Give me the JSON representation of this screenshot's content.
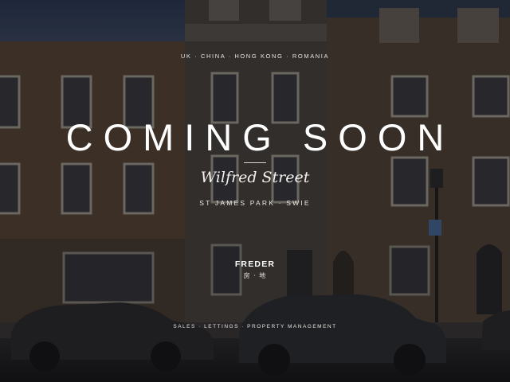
{
  "regions": "UK · CHINA · HONG KONG · ROMANIA",
  "headline": "COMING SOON",
  "street": "Wilfred Street",
  "area": "ST JAMES PARK · SWIE",
  "logo": {
    "word": "FREDER",
    "sub": "房 · 地"
  },
  "services": "SALES · LETTINGS · PROPERTY MANAGEMENT",
  "colors": {
    "overlay": "#0a0a0c",
    "brick": "#5b4a3a",
    "text": "#ffffff"
  }
}
